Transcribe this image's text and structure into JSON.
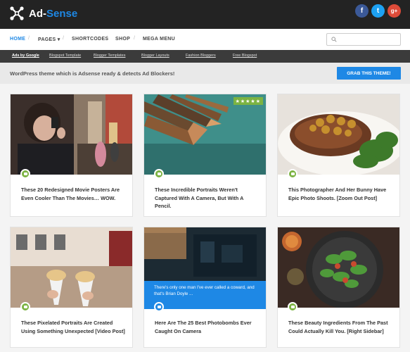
{
  "header": {
    "logo_text_1": "Ad-",
    "logo_text_2": "Sense",
    "social": [
      {
        "name": "facebook-icon",
        "glyph": "f",
        "color": "#3b5998"
      },
      {
        "name": "twitter-icon",
        "glyph": "t",
        "color": "#1da1f2"
      },
      {
        "name": "googleplus-icon",
        "glyph": "g+",
        "color": "#dd4b39"
      }
    ]
  },
  "nav": {
    "items": [
      "HOME",
      "PAGES",
      "SHORTCODES",
      "SHOP",
      "MEGA MENU"
    ],
    "pages_caret": "▾",
    "separator": "/",
    "search_placeholder": ""
  },
  "links": [
    "Ads by Google",
    "Blogspot Template",
    "Blogger Templates",
    "Blogger Layouts",
    "Fashion Bloggers",
    "Free Blogspot"
  ],
  "promo": {
    "text": "WordPress theme which is Adsense ready & detects Ad Blockers!",
    "button": "GRAB THIS THEME!"
  },
  "cards": [
    {
      "title": "These 20 Redesigned Movie Posters Are Even Cooler Than The Movies… WOW."
    },
    {
      "title": "These Incredible Portraits Weren't Captured With A Camera, But With A Pencil.",
      "rating": "★★★★★"
    },
    {
      "title": "This Photographer And Her Bunny Have Epic Photo Shoots. [Zoom Out Post]"
    },
    {
      "title": "These Pixelated Portraits Are Created Using Something Unexpected [Video Post]"
    },
    {
      "title": "Here Are The 25 Best Photobombs Ever Caught On Camera",
      "overlay": "There's only one man I've ever called a coward, and that's Brian Doyle ..."
    },
    {
      "title": "These Beauty Ingredients From The Past Could Actually Kill You. [Right Sidebar]"
    }
  ],
  "colors": {
    "accent": "#1e88e5",
    "badge_green": "#7cb342",
    "header_bg": "#232323"
  }
}
